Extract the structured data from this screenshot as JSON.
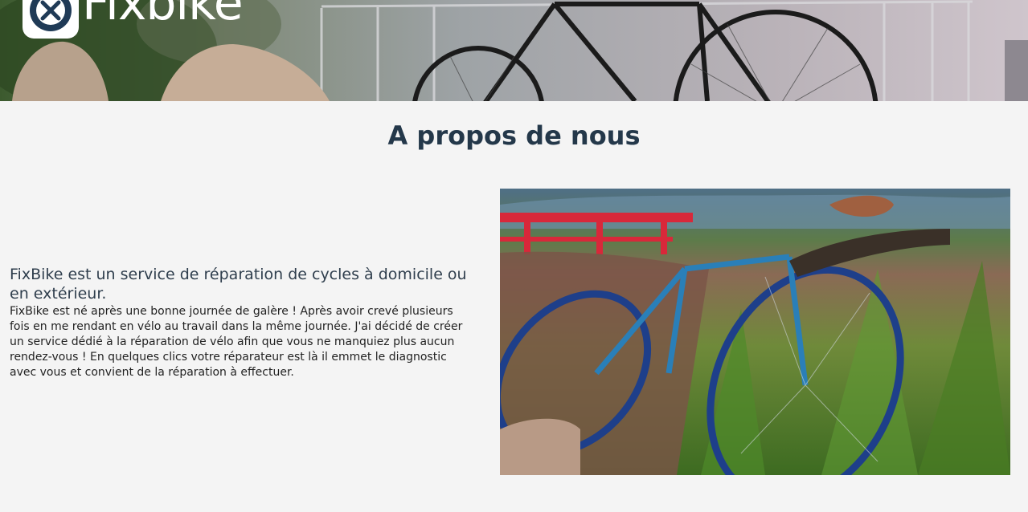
{
  "header": {
    "brand_name": "Fixbike",
    "logo_icon": "wrench-gear-icon",
    "banner_image": "bicycle-banner-photo"
  },
  "about": {
    "title": "A propos de nous",
    "heading": "FixBike est un service de réparation de cycles à domicile ou en extérieur.",
    "body": "FixBike est né après une bonne journée de galère ! Après avoir crevé plusieurs fois en me rendant en vélo au travail dans la même journée. J'ai décidé de créer un service dédié à la réparation de vélo afin que vous ne manquiez plus aucun rendez-vous ! En quelques clics votre réparateur est là il emmet le diagnostic avec vous et convient de la réparation à effectuer.",
    "photo": "bike-in-grass-photo"
  },
  "colors": {
    "page_background": "#f4f4f4",
    "title_color": "#24384a",
    "heading_color": "#2f3e4d",
    "logo_background": "#ffffff"
  }
}
